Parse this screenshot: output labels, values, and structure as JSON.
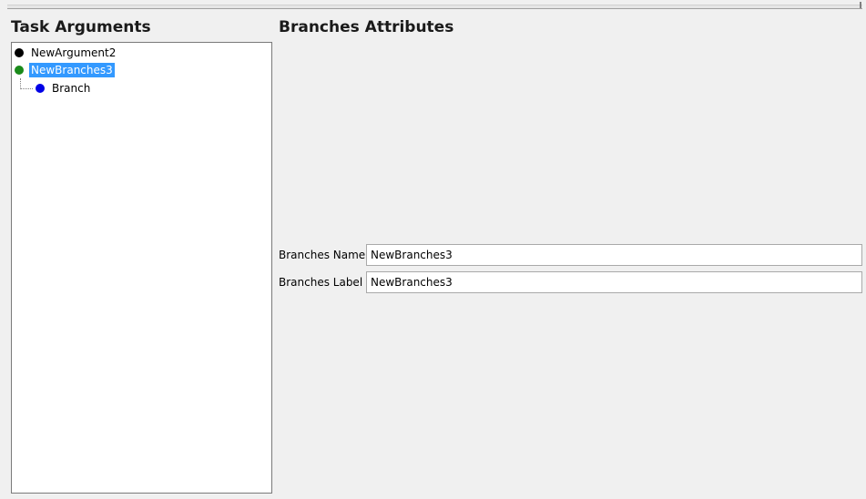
{
  "headings": {
    "task_arguments": "Task Arguments",
    "branches_attributes": "Branches Attributes"
  },
  "tree": {
    "items": [
      {
        "label": "NewArgument2",
        "icon": "black-circle-icon",
        "color": "#000000",
        "selected": false
      },
      {
        "label": "NewBranches3",
        "icon": "green-circle-icon",
        "color": "#1a8a1a",
        "selected": true
      },
      {
        "label": "Branch",
        "icon": "blue-circle-icon",
        "color": "#0000e6",
        "selected": false
      }
    ]
  },
  "form": {
    "branches_name": {
      "label": "Branches Name",
      "value": "NewBranches3"
    },
    "branches_label": {
      "label": "Branches Label",
      "value": "NewBranches3"
    }
  },
  "colors": {
    "selection": "#3399ff",
    "panel_bg": "#f0f0f0"
  }
}
